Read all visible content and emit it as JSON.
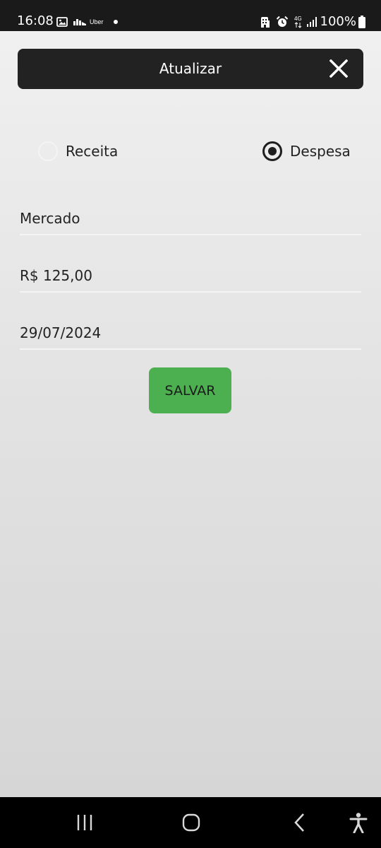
{
  "status_bar": {
    "time": "16:08",
    "app_label": "Uber",
    "battery": "100%",
    "network": "4G",
    "icons": [
      "image-icon",
      "uber-icon",
      "notification-dot",
      "building-icon",
      "alarm-icon",
      "network-4g-icon",
      "signal-icon",
      "battery-icon"
    ]
  },
  "header": {
    "title": "Atualizar",
    "close_icon": "close-icon"
  },
  "transaction_type": {
    "options": [
      {
        "label": "Receita",
        "selected": false
      },
      {
        "label": "Despesa",
        "selected": true
      }
    ]
  },
  "form": {
    "description": "Mercado",
    "amount": "R$ 125,00",
    "date": "29/07/2024",
    "save_label": "SALVAR"
  },
  "colors": {
    "header_bg": "#222222",
    "save_button": "#4caf50",
    "status_bar": "#1a1a1a",
    "nav_bar": "#000000"
  },
  "nav_bar": {
    "icons": [
      "recent-apps-icon",
      "home-icon",
      "back-icon",
      "accessibility-icon"
    ]
  }
}
